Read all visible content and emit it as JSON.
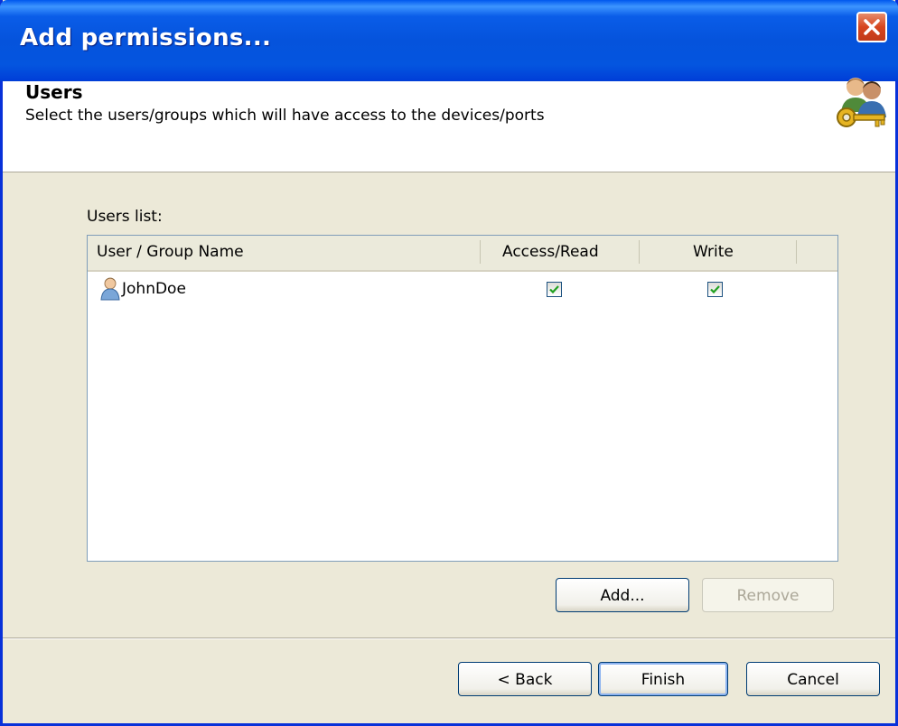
{
  "window": {
    "title": "Add permissions..."
  },
  "header": {
    "title": "Users",
    "subtitle": "Select the users/groups which will have access  to the devices/ports"
  },
  "users_list": {
    "label": "Users list:",
    "columns": [
      "User / Group Name",
      "Access/Read",
      "Write"
    ],
    "rows": [
      {
        "name": "JohnDoe",
        "access_read": true,
        "write": true
      }
    ]
  },
  "list_buttons": {
    "add": "Add...",
    "remove": "Remove"
  },
  "footer_buttons": {
    "back": "< Back",
    "finish": "Finish",
    "cancel": "Cancel"
  },
  "colors": {
    "titlebar": "#0553dc",
    "dialog_bg": "#ece9d8",
    "close": "#d6451e",
    "check": "#21a121"
  }
}
